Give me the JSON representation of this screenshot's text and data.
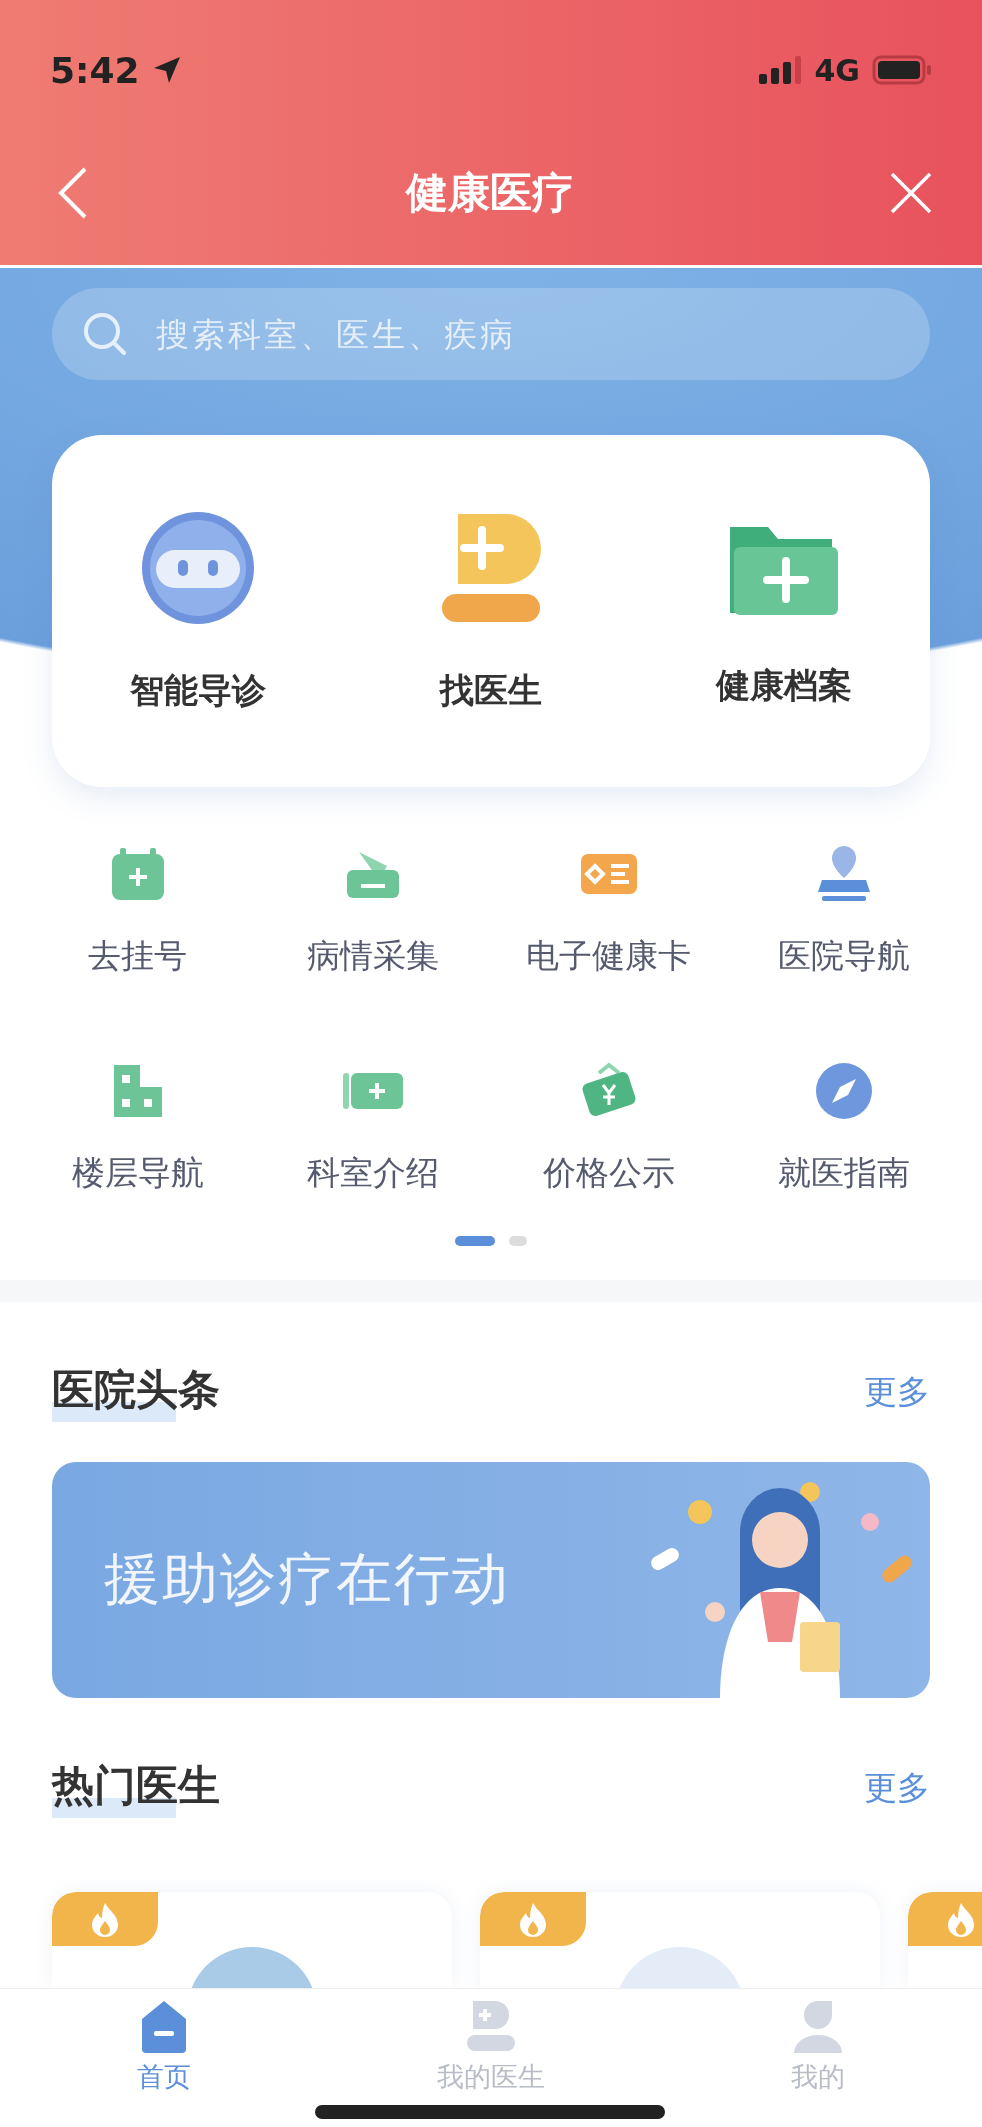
{
  "status_bar": {
    "time": "5:42",
    "network": "4G"
  },
  "nav": {
    "title": "健康医疗"
  },
  "search": {
    "placeholder": "搜索科室、医生、疾病"
  },
  "main_services": [
    {
      "kind": "robot",
      "label": "智能导诊"
    },
    {
      "kind": "doctor",
      "label": "找医生"
    },
    {
      "kind": "folder",
      "label": "健康档案"
    }
  ],
  "services": [
    {
      "kind": "register",
      "label": "去挂号"
    },
    {
      "kind": "collect",
      "label": "病情采集"
    },
    {
      "kind": "card",
      "label": "电子健康卡"
    },
    {
      "kind": "location",
      "label": "医院导航"
    },
    {
      "kind": "building",
      "label": "楼层导航"
    },
    {
      "kind": "department",
      "label": "科室介绍"
    },
    {
      "kind": "price",
      "label": "价格公示"
    },
    {
      "kind": "compass",
      "label": "就医指南"
    }
  ],
  "pager": [
    {
      "selected": true
    },
    {
      "selected": false
    }
  ],
  "news": {
    "title": "医院头条",
    "more": "更多",
    "banner": {
      "text": "援助诊疗在行动"
    }
  },
  "hot_doctors": {
    "title": "热门医生",
    "more": "更多",
    "cards": [
      {
        "hot": true
      },
      {
        "hot": true
      },
      {
        "hot": true
      }
    ]
  },
  "tab_bar": [
    {
      "kind": "home",
      "label": "首页",
      "selected": true
    },
    {
      "kind": "doctor",
      "label": "我的医生",
      "selected": false
    },
    {
      "kind": "user",
      "label": "我的",
      "selected": false
    }
  ]
}
